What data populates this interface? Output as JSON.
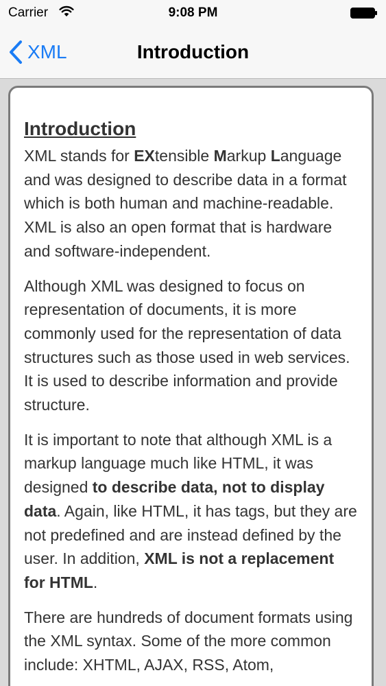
{
  "status_bar": {
    "carrier": "Carrier",
    "time": "9:08 PM",
    "icons": [
      "wifi-icon",
      "battery-icon"
    ]
  },
  "nav": {
    "back_label": "XML",
    "title": "Introduction",
    "accent_color": "#1a7cf5"
  },
  "article": {
    "heading": "Introduction",
    "p1": {
      "a": "XML stands for ",
      "b1": "EX",
      "c": "tensible ",
      "b2": "M",
      "d": "arkup ",
      "b3": "L",
      "e": "anguage and was designed to describe data in a format which is both human and machine-readable. XML is also an open format that is hardware and software-independent."
    },
    "p2": "Although XML was designed to focus on representation of documents, it is more commonly used for the representation of data structures such as those used in web services. It is used to describe information and provide structure.",
    "p3": {
      "a": "It is important to note that although XML is a markup language much like HTML, it was designed ",
      "b1": "to describe data, not to display data",
      "c": ". Again, like HTML, it has tags, but they are not predefined and are instead defined by the user. In addition, ",
      "b2": "XML is not a replacement for HTML",
      "d": "."
    },
    "p4": "There are hundreds of document formats using the XML syntax. Some of the more common include: XHTML, AJAX, RSS, Atom,"
  }
}
